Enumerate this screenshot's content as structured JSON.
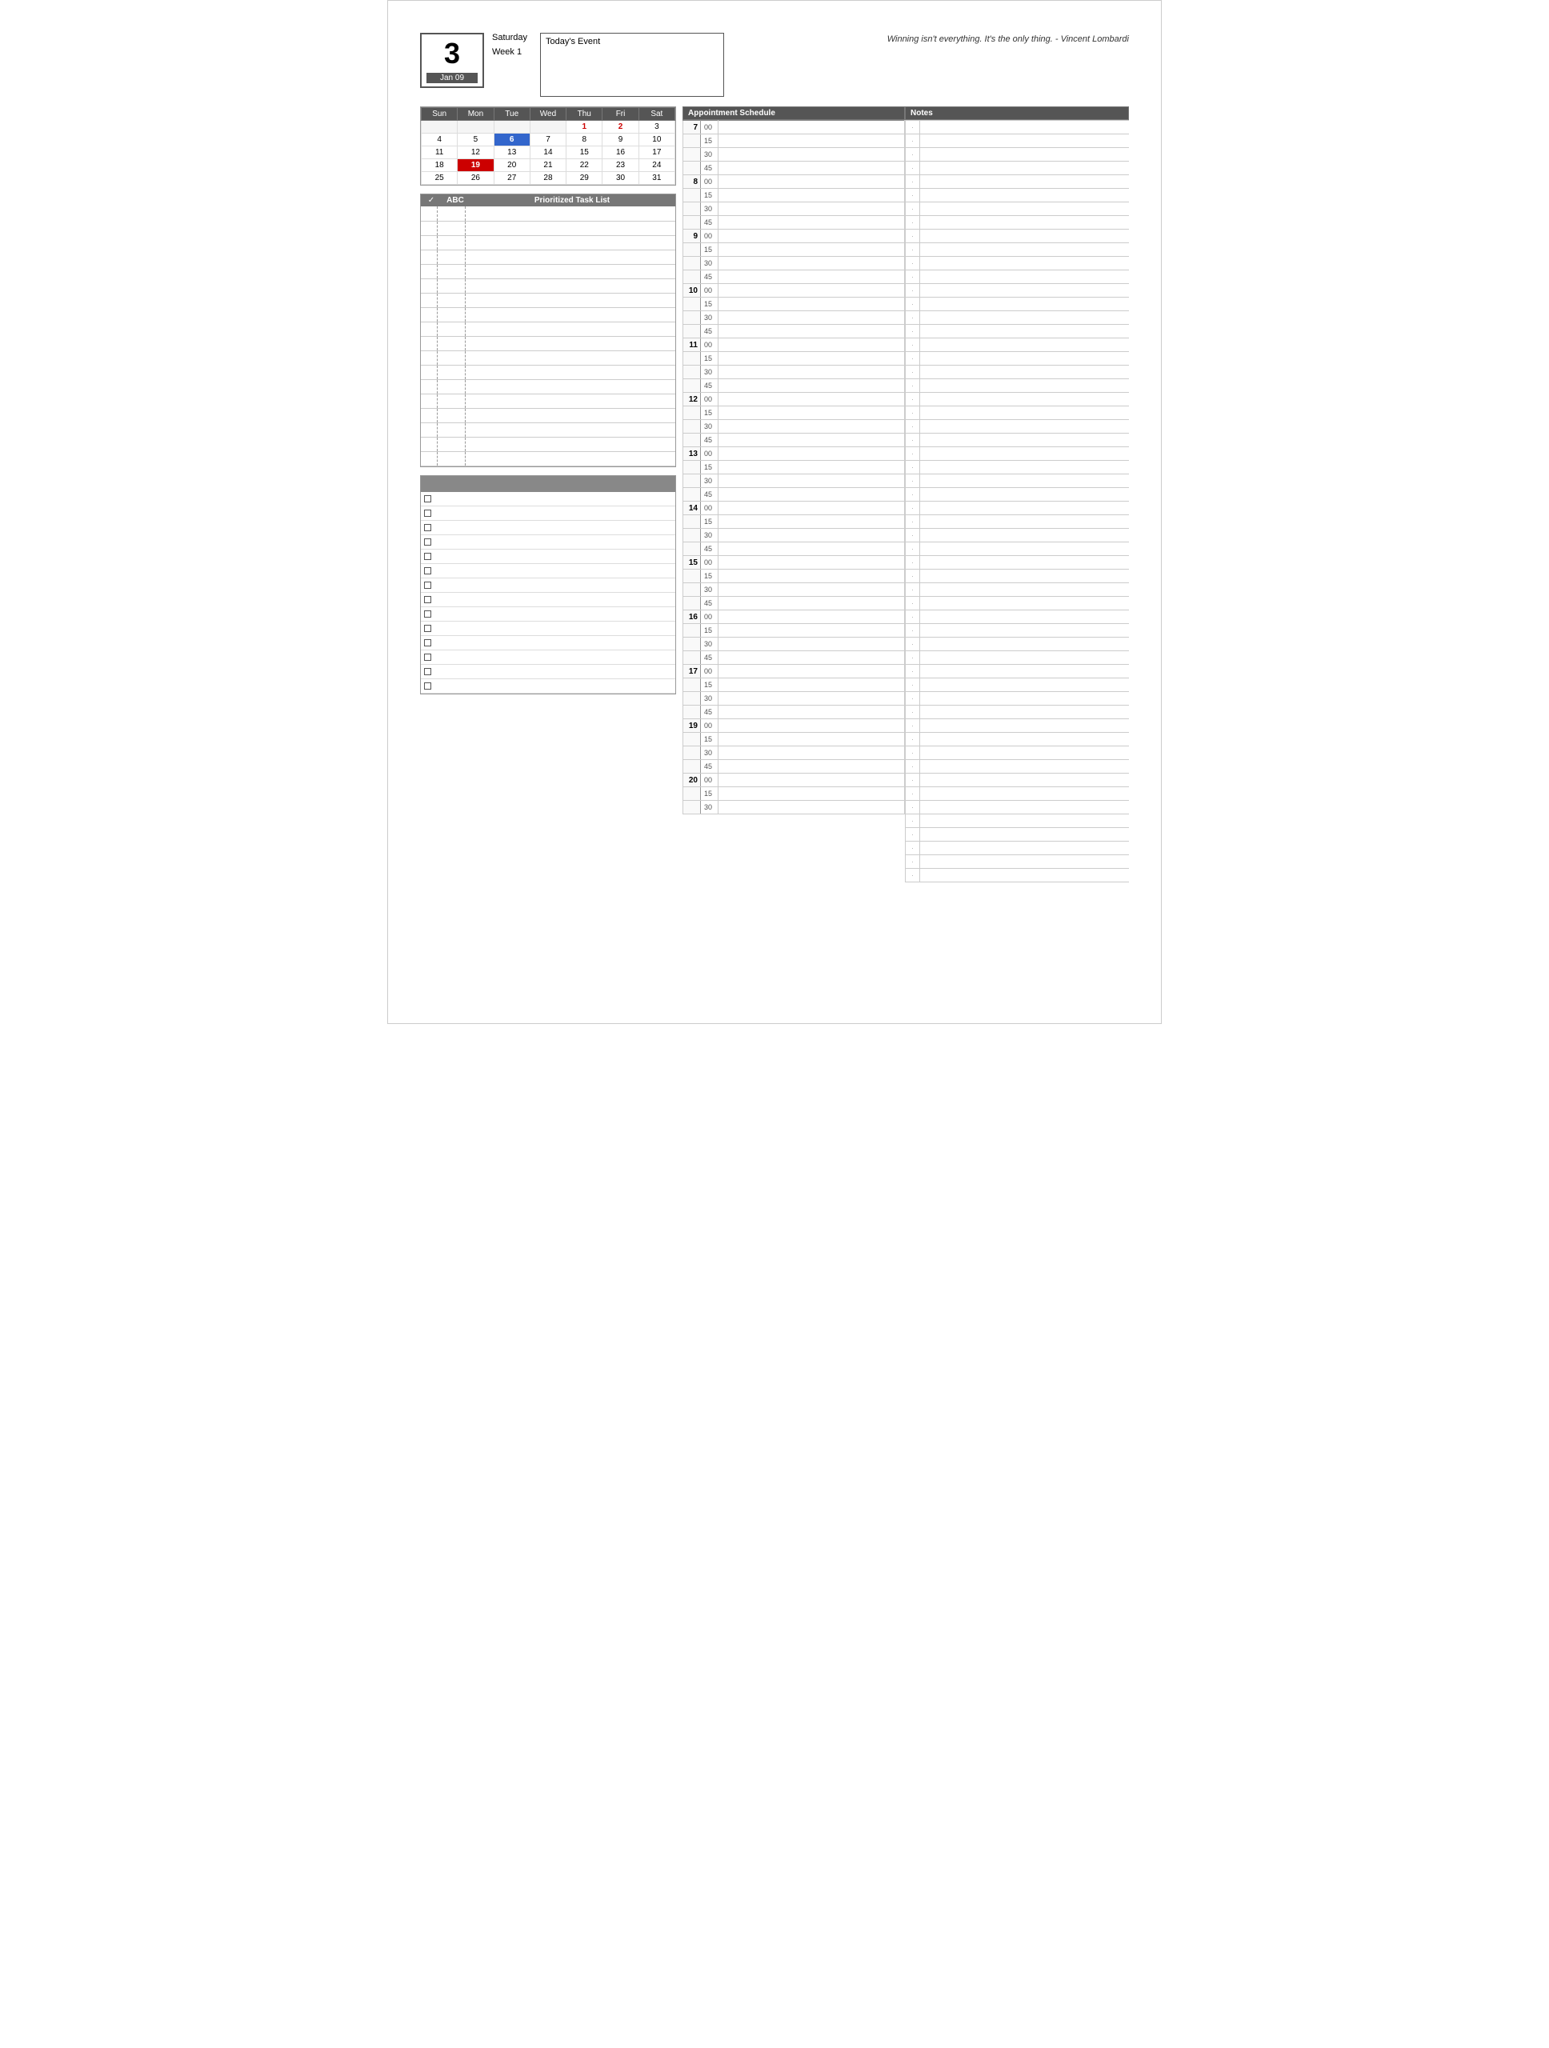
{
  "header": {
    "day_number": "3",
    "day_name": "Saturday",
    "week_label": "Week 1",
    "month_label": "Jan 09",
    "todays_event_title": "Today's Event",
    "quote": "Winning isn't everything. It's the only thing. - Vincent Lombardi"
  },
  "calendar": {
    "headers": [
      "Sun",
      "Mon",
      "Tue",
      "Wed",
      "Thu",
      "Fri",
      "Sat"
    ],
    "weeks": [
      [
        "",
        "",
        "",
        "",
        "1",
        "2",
        "3"
      ],
      [
        "4",
        "5",
        "6",
        "7",
        "8",
        "9",
        "10"
      ],
      [
        "11",
        "12",
        "13",
        "14",
        "15",
        "16",
        "17"
      ],
      [
        "18",
        "19",
        "20",
        "21",
        "22",
        "23",
        "24"
      ],
      [
        "25",
        "26",
        "27",
        "28",
        "29",
        "30",
        "31"
      ]
    ],
    "special": {
      "red_dates": [
        "1",
        "2"
      ],
      "blue_date": "6",
      "today_date": "19"
    }
  },
  "task_list": {
    "header_check": "✓",
    "header_abc": "ABC",
    "header_title": "Prioritized Task List",
    "rows": 18
  },
  "checklist": {
    "items": 14
  },
  "appointment_schedule": {
    "title": "Appointment Schedule",
    "slots": [
      {
        "hour": "7",
        "minutes": [
          "00",
          "15",
          "30",
          "45"
        ]
      },
      {
        "hour": "8",
        "minutes": [
          "00",
          "15",
          "30",
          "45"
        ]
      },
      {
        "hour": "9",
        "minutes": [
          "00",
          "15",
          "30",
          "45"
        ]
      },
      {
        "hour": "10",
        "minutes": [
          "00",
          "15",
          "30",
          "45"
        ]
      },
      {
        "hour": "11",
        "minutes": [
          "00",
          "15",
          "30",
          "45"
        ]
      },
      {
        "hour": "12",
        "minutes": [
          "00",
          "15",
          "30",
          "45"
        ]
      },
      {
        "hour": "13",
        "minutes": [
          "00",
          "15",
          "30",
          "45"
        ]
      },
      {
        "hour": "14",
        "minutes": [
          "00",
          "15",
          "30",
          "45"
        ]
      },
      {
        "hour": "15",
        "minutes": [
          "00",
          "15",
          "30",
          "45"
        ]
      },
      {
        "hour": "16",
        "minutes": [
          "00",
          "15",
          "30",
          "45"
        ]
      },
      {
        "hour": "17",
        "minutes": [
          "00",
          "15",
          "30",
          "45"
        ]
      },
      {
        "hour": "19",
        "minutes": [
          "00",
          "15",
          "30",
          "45"
        ]
      },
      {
        "hour": "20",
        "minutes": [
          "00",
          "15",
          "30"
        ]
      }
    ]
  },
  "notes": {
    "title": "Notes",
    "rows": 56
  }
}
